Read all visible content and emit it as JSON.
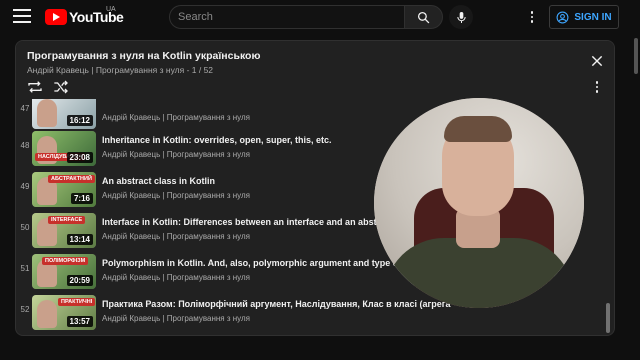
{
  "header": {
    "logo_text": "YouTube",
    "region": "UA",
    "search_placeholder": "Search",
    "signin_label": "SIGN IN"
  },
  "playlist": {
    "title": "Програмування з нуля на Kotlin українською",
    "subtitle": "Андрій Кравець | Програмування з нуля - 1 / 52",
    "items": [
      {
        "index": "47",
        "title": "",
        "meta": "Андрій Кравець | Програмування з нуля",
        "duration": "16:12",
        "tag": ""
      },
      {
        "index": "48",
        "title": "Inheritance in Kotlin: overrides, open, super, this, etc.",
        "meta": "Андрій Кравець | Програмування з нуля",
        "duration": "23:08",
        "tag": "НАСЛІДУВАННЯ"
      },
      {
        "index": "49",
        "title": "An abstract class in Kotlin",
        "meta": "Андрій Кравець | Програмування з нуля",
        "duration": "7:16",
        "tag": "АБСТРАКТНИЙ"
      },
      {
        "index": "50",
        "title": "Interface in Kotlin: Differences between an interface and an abstract",
        "meta": "Андрій Кравець | Програмування з нуля",
        "duration": "13:14",
        "tag": "INTERFACE"
      },
      {
        "index": "51",
        "title": "Polymorphism in Kotlin. And, also, polymorphic argument and type casti",
        "meta": "Андрій Кравець | Програмування з нуля",
        "duration": "20:59",
        "tag": "ПОЛІМОРФІЗМ"
      },
      {
        "index": "52",
        "title": "Практика Разом: Поліморфічний аргумент, Наслідування, Клас в класі (агрега",
        "meta": "Андрій Кравець | Програмування з нуля",
        "duration": "13:57",
        "tag": "ПРАКТИЧНІ"
      }
    ]
  },
  "colors": {
    "brand_red": "#ff0000",
    "accent_blue": "#3ea6ff",
    "background": "#0f0f0f",
    "panel": "#212121"
  },
  "icons": [
    "menu-icon",
    "youtube-logo-icon",
    "search-icon",
    "mic-icon",
    "more-vert-icon",
    "account-icon",
    "close-icon",
    "loop-icon",
    "shuffle-icon"
  ]
}
